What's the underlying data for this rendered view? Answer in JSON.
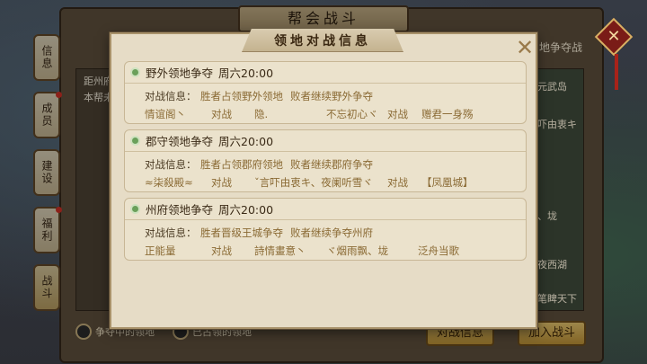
{
  "background": {
    "window_title": "帮会战斗",
    "side_tabs": [
      {
        "label": "信息",
        "dot": false,
        "active": false
      },
      {
        "label": "成员",
        "dot": true,
        "active": false
      },
      {
        "label": "建设",
        "dot": false,
        "active": false
      },
      {
        "label": "福利",
        "dot": true,
        "active": false
      },
      {
        "label": "战斗",
        "dot": false,
        "active": true
      }
    ],
    "left_card_lines": [
      "距州府",
      "本帮未"
    ],
    "right_tab": "地争夺战",
    "right_labels": [
      "元武岛",
      "吓由衷キ",
      "、垅",
      "夜西湖",
      "笔睥天下"
    ],
    "legend_contested": "争夺中的领地",
    "legend_owned": "已占领的领地",
    "btn_battle_info": "对战信息",
    "btn_join_battle": "加入战斗"
  },
  "modal": {
    "title": "领地对战信息",
    "close_symbol": "✕",
    "info_label": "对战信息：",
    "vs_label": "对战",
    "sections": [
      {
        "name": "野外领地争夺",
        "time": "周六20:00",
        "rule": "胜者占领野外领地",
        "rule2": "败者继续野外争夺",
        "team_a1": "情谊阁丶",
        "team_a2": "隐.",
        "team_b1": "不忘初心ヾ",
        "team_b2": "赠君一身殇"
      },
      {
        "name": "郡守领地争夺",
        "time": "周六20:00",
        "rule": "胜者占领郡府领地",
        "rule2": "败者继续郡府争夺",
        "team_a1": "≈柒殺殿≈",
        "team_a2": "ˇ言吓由衷キ、夜阑听雪ヾ",
        "team_b1": "",
        "team_b2": "【凤凰城】"
      },
      {
        "name": "州府领地争夺",
        "time": "周六20:00",
        "rule": "胜者晋级王城争夺",
        "rule2": "败者继续争夺州府",
        "team_a1": "正能量",
        "team_a2": "詩情畫意丶",
        "team_b1": "ヾ烟雨飘、垅",
        "team_b2": "泛舟当歌"
      }
    ]
  }
}
